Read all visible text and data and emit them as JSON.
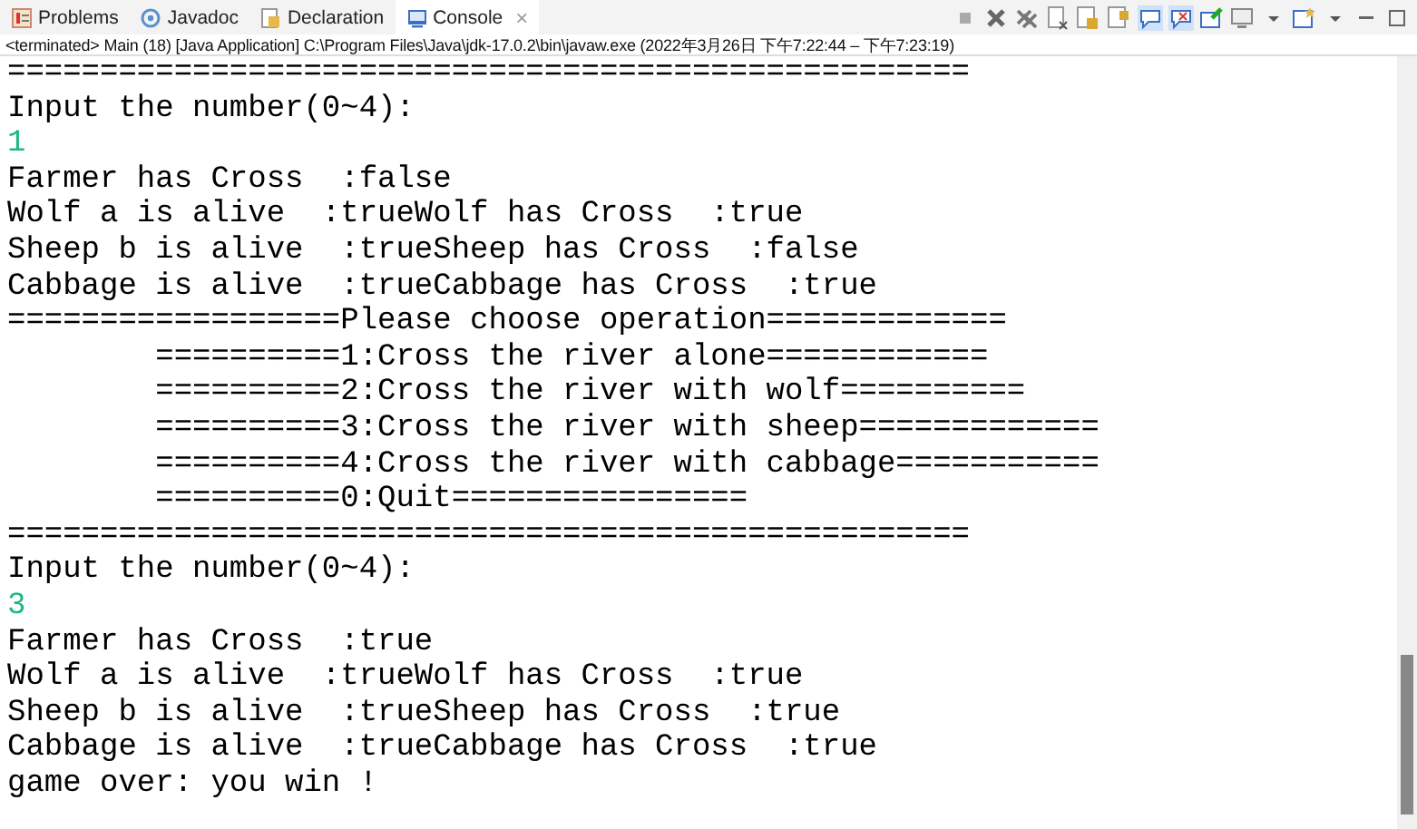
{
  "tabs": [
    {
      "label": "Problems",
      "selected": false
    },
    {
      "label": "Javadoc",
      "selected": false
    },
    {
      "label": "Declaration",
      "selected": false
    },
    {
      "label": "Console",
      "selected": true
    }
  ],
  "close_glyph": "×",
  "status": "<terminated> Main (18) [Java Application] C:\\Program Files\\Java\\jdk-17.0.2\\bin\\javaw.exe  (2022年3月26日 下午7:22:44 – 下午7:23:19)",
  "console_lines": [
    {
      "kind": "output",
      "text": "===================================================="
    },
    {
      "kind": "output",
      "text": "Input the number(0~4):"
    },
    {
      "kind": "input",
      "text": "1"
    },
    {
      "kind": "output",
      "text": "Farmer has Cross  :false"
    },
    {
      "kind": "output",
      "text": "Wolf a is alive  :trueWolf has Cross  :true"
    },
    {
      "kind": "output",
      "text": "Sheep b is alive  :trueSheep has Cross  :false"
    },
    {
      "kind": "output",
      "text": "Cabbage is alive  :trueCabbage has Cross  :true"
    },
    {
      "kind": "output",
      "text": "==================Please choose operation============="
    },
    {
      "kind": "output",
      "text": "        ==========1:Cross the river alone============"
    },
    {
      "kind": "output",
      "text": "        ==========2:Cross the river with wolf=========="
    },
    {
      "kind": "output",
      "text": "        ==========3:Cross the river with sheep============="
    },
    {
      "kind": "output",
      "text": "        ==========4:Cross the river with cabbage==========="
    },
    {
      "kind": "output",
      "text": "        ==========0:Quit================"
    },
    {
      "kind": "output",
      "text": "===================================================="
    },
    {
      "kind": "output",
      "text": "Input the number(0~4):"
    },
    {
      "kind": "input",
      "text": "3"
    },
    {
      "kind": "output",
      "text": "Farmer has Cross  :true"
    },
    {
      "kind": "output",
      "text": "Wolf a is alive  :trueWolf has Cross  :true"
    },
    {
      "kind": "output",
      "text": "Sheep b is alive  :trueSheep has Cross  :true"
    },
    {
      "kind": "output",
      "text": "Cabbage is alive  :trueCabbage has Cross  :true"
    },
    {
      "kind": "output",
      "text": "game over: you win !"
    }
  ]
}
